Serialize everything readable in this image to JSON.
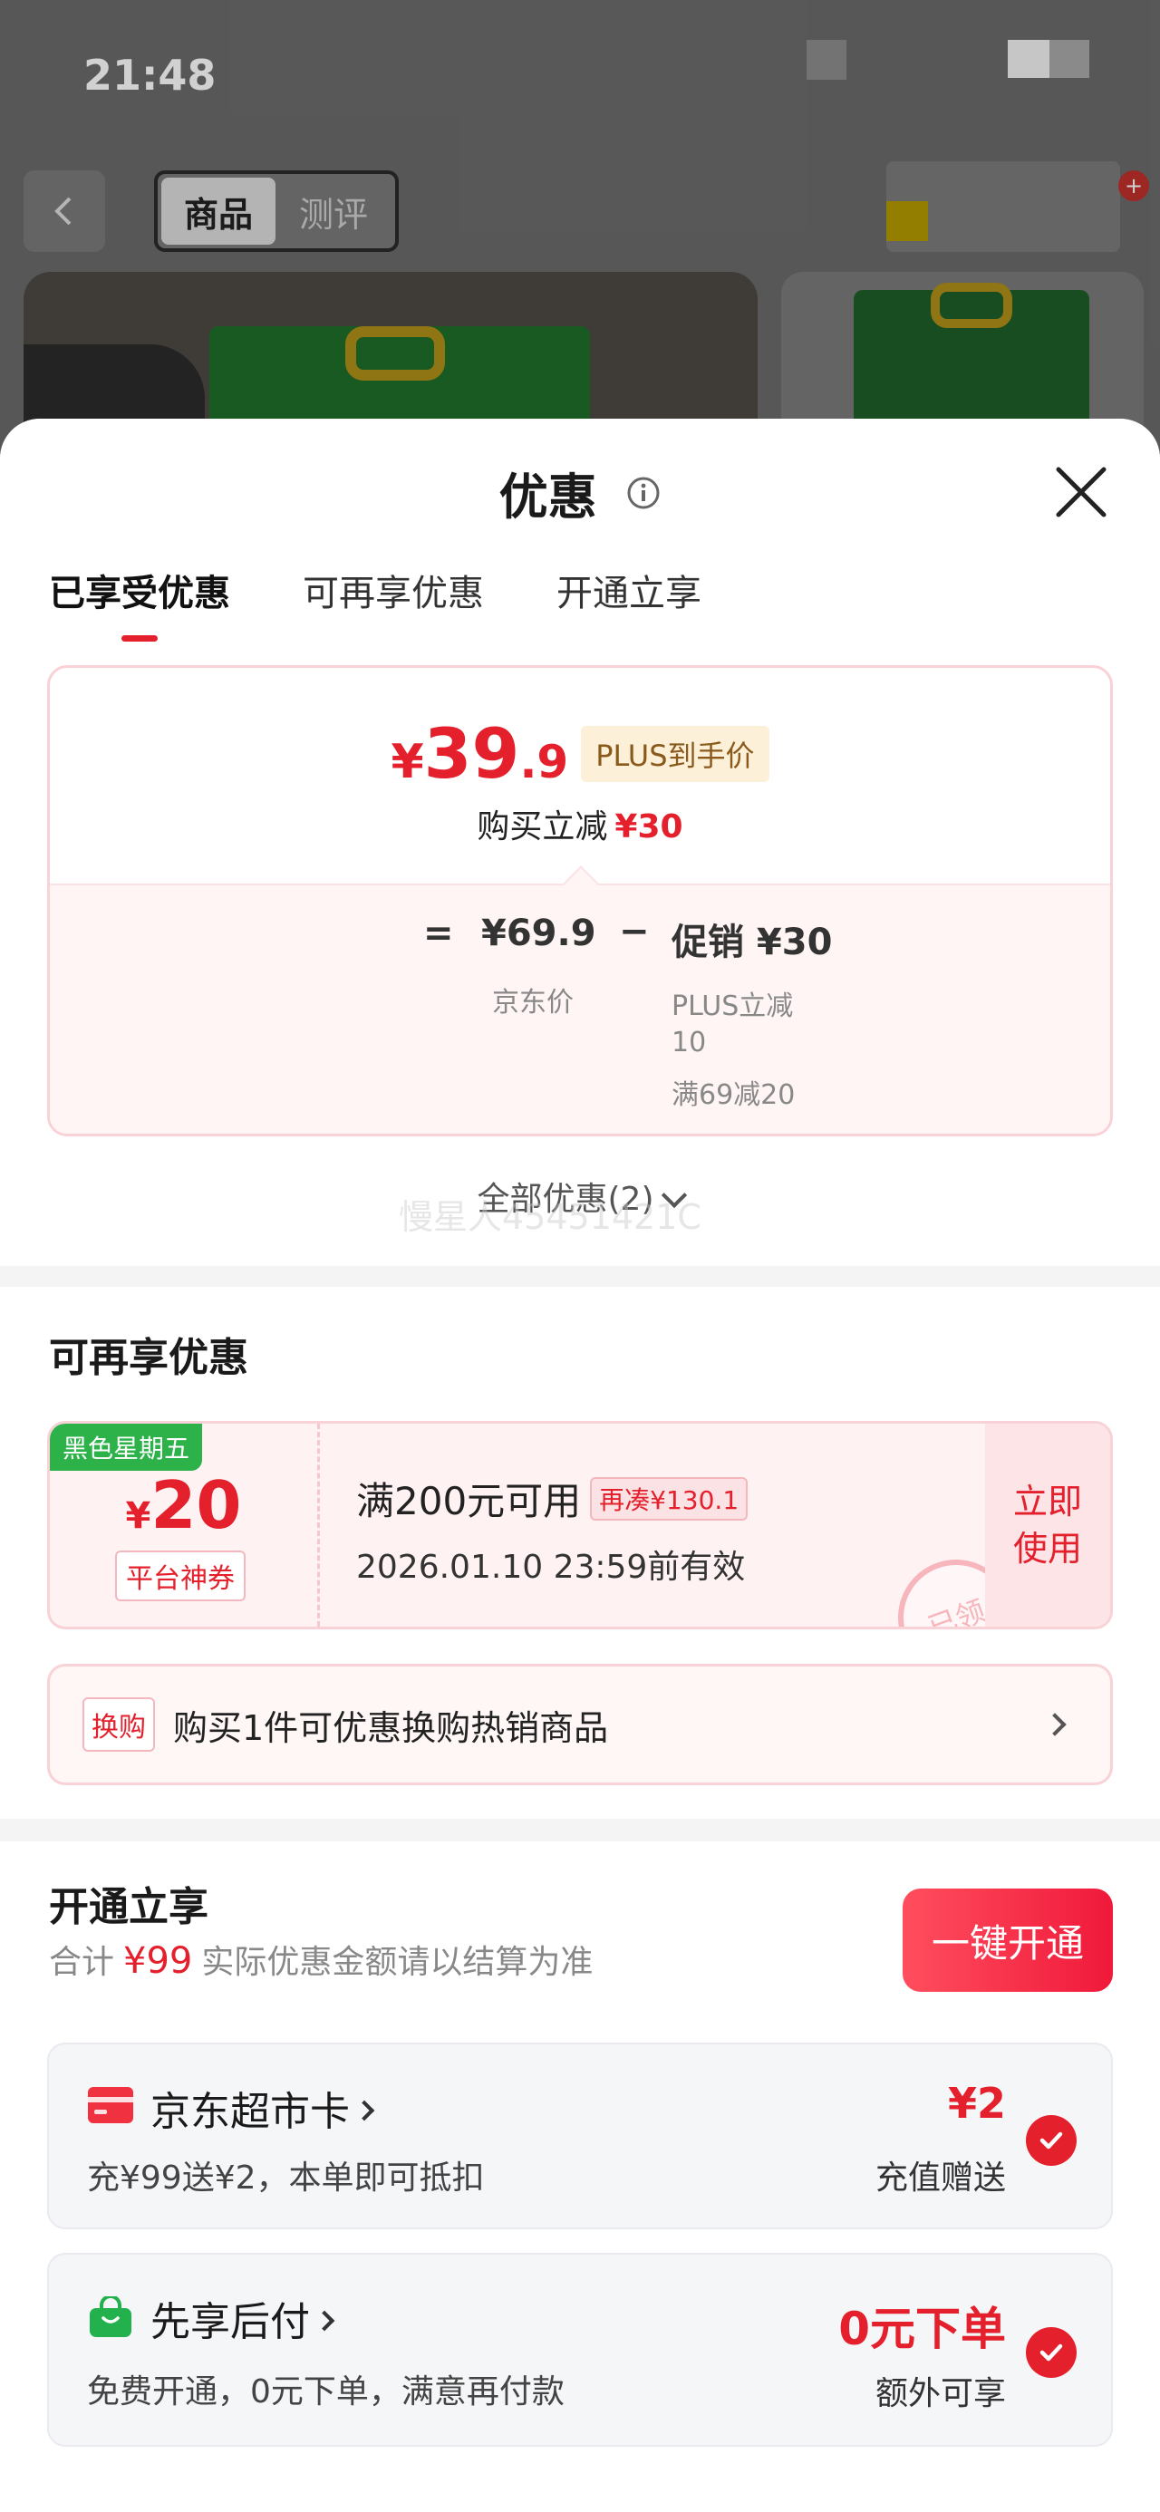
{
  "status_bar": {
    "time": "21:48"
  },
  "background_page": {
    "tabs": [
      {
        "label": "商品"
      },
      {
        "label": "测评"
      }
    ]
  },
  "sheet": {
    "title": "优惠",
    "tabs": [
      {
        "label": "已享受优惠",
        "active": true
      },
      {
        "label": "可再享优惠",
        "active": false
      },
      {
        "label": "开通立享",
        "active": false
      }
    ],
    "price_card": {
      "currency": "¥",
      "price_int": "39",
      "price_dec": ".9",
      "price_tag": "PLUS到手价",
      "discount_label": "购买立减",
      "discount_value": "¥30",
      "equals": "=",
      "base_price": "¥69.9",
      "base_label": "京东价",
      "minus": "−",
      "promo_value": "促销 ¥30",
      "promo_line1": "PLUS立减10",
      "promo_line2": "满69减20"
    },
    "all_offers": "全部优惠(2)",
    "watermark": "慢星人45451421C"
  },
  "more_offers": {
    "title": "可再享优惠",
    "coupon": {
      "tag": "黑色星期五",
      "currency": "¥",
      "amount": "20",
      "kind": "平台神券",
      "condition": "满200元可用",
      "top_up": "再凑¥130.1",
      "validity": "2026.01.10 23:59前有效",
      "action_line1": "立即",
      "action_line2": "使用",
      "stamp": "已领"
    },
    "exchange": {
      "tag": "换购",
      "text": "购买1件可优惠换购热销商品"
    }
  },
  "membership": {
    "title": "开通立享",
    "sum_label": "合计",
    "sum_value": "¥99",
    "sum_note": "实际优惠金额请以结算为准",
    "open_button": "一键开通",
    "services": [
      {
        "name": "京东超市卡",
        "desc": "充¥99送¥2，本单即可抵扣",
        "amount": "¥2",
        "note": "充值赠送",
        "icon": "card-icon",
        "icon_color": "#f0313f"
      },
      {
        "name": "先享后付",
        "desc": "免费开通，0元下单，满意再付款",
        "amount": "0元下单",
        "note": "额外可享",
        "icon": "shopping-bag-icon",
        "icon_color": "#22b14c"
      }
    ]
  },
  "colors": {
    "accent": "#e4202c",
    "coupon_tag": "#2db24a"
  }
}
